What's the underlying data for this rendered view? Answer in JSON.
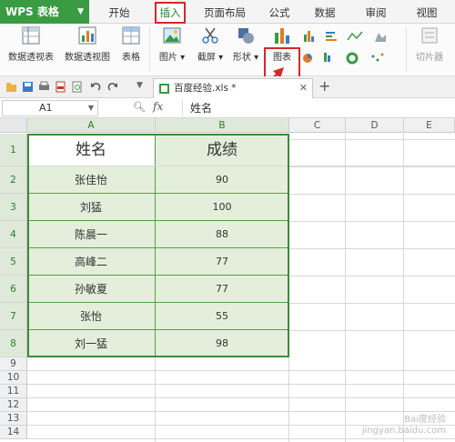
{
  "app": {
    "name": "WPS 表格"
  },
  "menu": {
    "tabs": [
      {
        "label": "开始"
      },
      {
        "label": "插入"
      },
      {
        "label": "页面布局"
      },
      {
        "label": "公式"
      },
      {
        "label": "数据"
      },
      {
        "label": "审阅"
      },
      {
        "label": "视图"
      }
    ],
    "active": "插入"
  },
  "ribbon": {
    "pivot_table": "数据透视表",
    "pivot_chart": "数据透视图",
    "table": "表格",
    "picture": "图片",
    "screenshot": "截屏",
    "shapes": "形状",
    "chart": "图表",
    "slicer": "切片器"
  },
  "document": {
    "tab_title": "百度经验.xls *"
  },
  "formula_bar": {
    "cell_ref": "A1",
    "fx": "fx",
    "content": "姓名"
  },
  "sheet": {
    "columns": [
      "A",
      "B",
      "C",
      "D",
      "E"
    ],
    "rows": [
      "1",
      "2",
      "3",
      "4",
      "5",
      "6",
      "7",
      "8",
      "9",
      "10",
      "11",
      "12",
      "13",
      "14"
    ],
    "header": [
      "姓名",
      "成绩"
    ],
    "records": [
      {
        "name": "张佳怡",
        "score": "90"
      },
      {
        "name": "刘猛",
        "score": "100"
      },
      {
        "name": "陈晨一",
        "score": "88"
      },
      {
        "name": "高峰二",
        "score": "77"
      },
      {
        "name": "孙敏夏",
        "score": "77"
      },
      {
        "name": "张怡",
        "score": "55"
      },
      {
        "name": "刘一猛",
        "score": "98"
      }
    ]
  },
  "colors": {
    "accent": "#3a9b42",
    "highlight": "#d12a2a",
    "data_fill": "#e3efdb"
  },
  "watermark": {
    "line1": "Bai度经验",
    "line2": "jingyan.baidu.com"
  }
}
